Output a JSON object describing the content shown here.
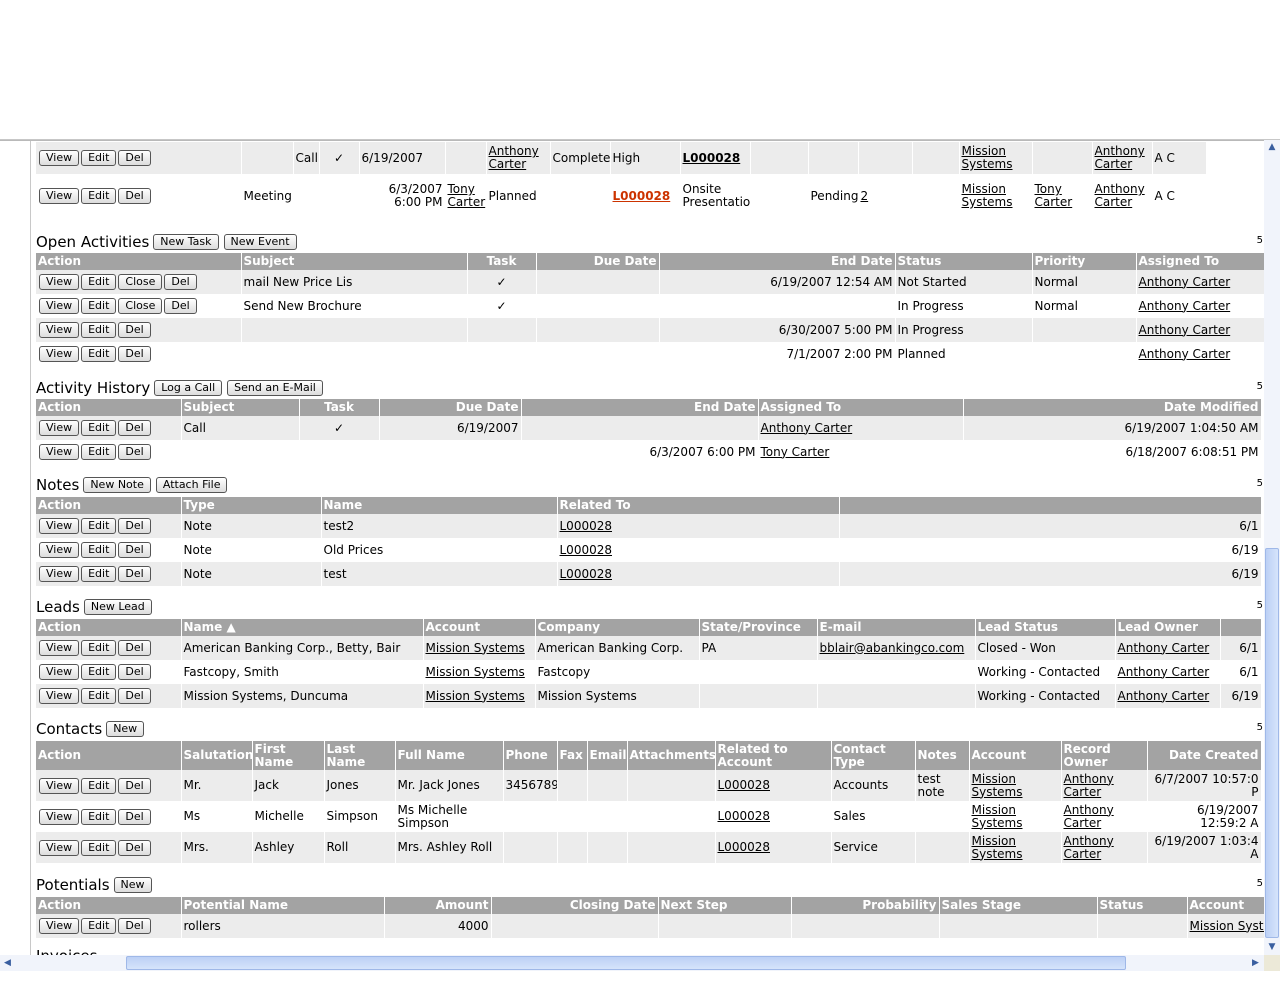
{
  "buttons": {
    "view": "View",
    "edit": "Edit",
    "del": "Del",
    "close": "Close"
  },
  "top_rows": [
    {
      "type": "Call",
      "task": "✓",
      "due": "6/19/2007",
      "assigned": "Anthony Carter",
      "status": "Completed",
      "priority": "High",
      "lead": "L000028",
      "account": "Mission Systems",
      "owner": "Anthony Carter",
      "trail": "A C"
    },
    {
      "type": "Meeting",
      "start": "6/3/2007 6:00 PM",
      "assigned": "Tony Carter",
      "status": "Planned",
      "lead": "L000028",
      "subject": "Onsite Presentation",
      "result": "Pending",
      "count": "2",
      "account": "Mission Systems",
      "contact": "Tony Carter",
      "owner": "Anthony Carter",
      "trail": "A C"
    }
  ],
  "open_activities": {
    "title": "Open Activities",
    "buttons": [
      "New Task",
      "New Event"
    ],
    "columns": [
      "Action",
      "Subject",
      "Task",
      "Due Date",
      "End Date",
      "Status",
      "Priority",
      "Assigned To"
    ],
    "rows": [
      {
        "subject": "mail New Price Lis",
        "task": "✓",
        "due": "",
        "end": "6/19/2007 12:54 AM",
        "status": "Not Started",
        "priority": "Normal",
        "assigned": "Anthony Carter",
        "close": true
      },
      {
        "subject": "Send New Brochure",
        "task": "✓",
        "due": "",
        "end": "",
        "status": "In Progress",
        "priority": "Normal",
        "assigned": "Anthony Carter",
        "close": true
      },
      {
        "subject": "",
        "task": "",
        "due": "",
        "end": "6/30/2007 5:00 PM",
        "status": "In Progress",
        "priority": "",
        "assigned": "Anthony Carter",
        "close": false
      },
      {
        "subject": "",
        "task": "",
        "due": "",
        "end": "7/1/2007 2:00 PM",
        "status": "Planned",
        "priority": "",
        "assigned": "Anthony Carter",
        "close": false
      }
    ]
  },
  "activity_history": {
    "title": "Activity History",
    "buttons": [
      "Log a Call",
      "Send an E-Mail"
    ],
    "columns": [
      "Action",
      "Subject",
      "Task",
      "Due Date",
      "End Date",
      "Assigned To",
      "Date Modified"
    ],
    "rows": [
      {
        "subject": "Call",
        "task": "✓",
        "due": "6/19/2007",
        "end": "",
        "assigned": "Anthony Carter",
        "modified": "6/19/2007 1:04:50 AM"
      },
      {
        "subject": "",
        "task": "",
        "due": "",
        "end": "6/3/2007 6:00 PM",
        "assigned": "Tony Carter",
        "modified": "6/18/2007 6:08:51 PM"
      }
    ]
  },
  "notes": {
    "title": "Notes",
    "buttons": [
      "New Note",
      "Attach File"
    ],
    "columns": [
      "Action",
      "Type",
      "Name",
      "Related To",
      ""
    ],
    "rows": [
      {
        "type": "Note",
        "name": "test2",
        "related": "L000028",
        "trail": "6/1"
      },
      {
        "type": "Note",
        "name": "Old Prices",
        "related": "L000028",
        "trail": "6/19"
      },
      {
        "type": "Note",
        "name": "test",
        "related": "L000028",
        "trail": "6/19"
      }
    ]
  },
  "leads": {
    "title": "Leads",
    "buttons": [
      "New Lead"
    ],
    "columns": [
      "Action",
      "Name ▲",
      "Account",
      "Company",
      "State/Province",
      "E-mail",
      "Lead Status",
      "Lead Owner",
      ""
    ],
    "rows": [
      {
        "name": "American Banking Corp., Betty, Bair",
        "account": "Mission Systems",
        "company": "American Banking Corp.",
        "state": "PA",
        "email": "bblair@abankingco.com",
        "status": "Closed - Won",
        "owner": "Anthony Carter",
        "trail": "6/1"
      },
      {
        "name": "Fastcopy, Smith",
        "account": "Mission Systems",
        "company": "Fastcopy",
        "state": "",
        "email": "",
        "status": "Working - Contacted",
        "owner": "Anthony Carter",
        "trail": "6/1"
      },
      {
        "name": "Mission Systems, Duncuma",
        "account": "Mission Systems",
        "company": "Mission Systems",
        "state": "",
        "email": "",
        "status": "Working - Contacted",
        "owner": "Anthony Carter",
        "trail": "6/19"
      }
    ]
  },
  "contacts": {
    "title": "Contacts",
    "buttons": [
      "New"
    ],
    "columns": [
      "Action",
      "Salutation",
      "First Name",
      "Last Name",
      "Full Name",
      "Phone",
      "Fax",
      "Email",
      "Attachments",
      "Related to Account",
      "Contact Type",
      "Notes",
      "Account",
      "Record Owner",
      "Date Created"
    ],
    "rows": [
      {
        "sal": "Mr.",
        "first": "Jack",
        "last": "Jones",
        "full": "Mr. Jack Jones",
        "phone": "3456789",
        "related": "L000028",
        "ctype": "Accounts",
        "notes": "test note",
        "account": "Mission Systems",
        "owner": "Anthony Carter",
        "created": "6/7/2007 10:57:0 P"
      },
      {
        "sal": "Ms",
        "first": "Michelle",
        "last": "Simpson",
        "full": "Ms Michelle Simpson",
        "phone": "",
        "related": "L000028",
        "ctype": "Sales",
        "notes": "",
        "account": "Mission Systems",
        "owner": "Anthony Carter",
        "created": "6/19/2007 12:59:2 A"
      },
      {
        "sal": "Mrs.",
        "first": "Ashley",
        "last": "Roll",
        "full": "Mrs. Ashley Roll",
        "phone": "",
        "related": "L000028",
        "ctype": "Service",
        "notes": "",
        "account": "Mission Systems",
        "owner": "Anthony Carter",
        "created": "6/19/2007 1:03:4 A"
      }
    ]
  },
  "potentials": {
    "title": "Potentials",
    "buttons": [
      "New"
    ],
    "columns": [
      "Action",
      "Potential Name",
      "Amount",
      "Closing Date",
      "Next Step",
      "Probability",
      "Sales Stage",
      "Status",
      "Account"
    ],
    "rows": [
      {
        "name": "rollers",
        "amount": "4000",
        "account": "Mission Syste"
      }
    ]
  },
  "next_section_partial": "Invoices",
  "section_mark": "5"
}
